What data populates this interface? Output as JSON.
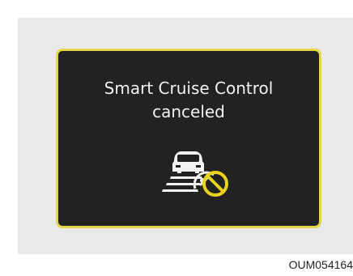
{
  "cluster_message": {
    "line1": "Smart Cruise Control",
    "line2": "canceled"
  },
  "icon": {
    "name": "smart-cruise-control-canceled-icon"
  },
  "figure_code": "OUM054164",
  "colors": {
    "display_background": "#222222",
    "display_border": "#e6d54a",
    "text": "#f2f2f2",
    "cancel_symbol": "#e8d21d"
  }
}
